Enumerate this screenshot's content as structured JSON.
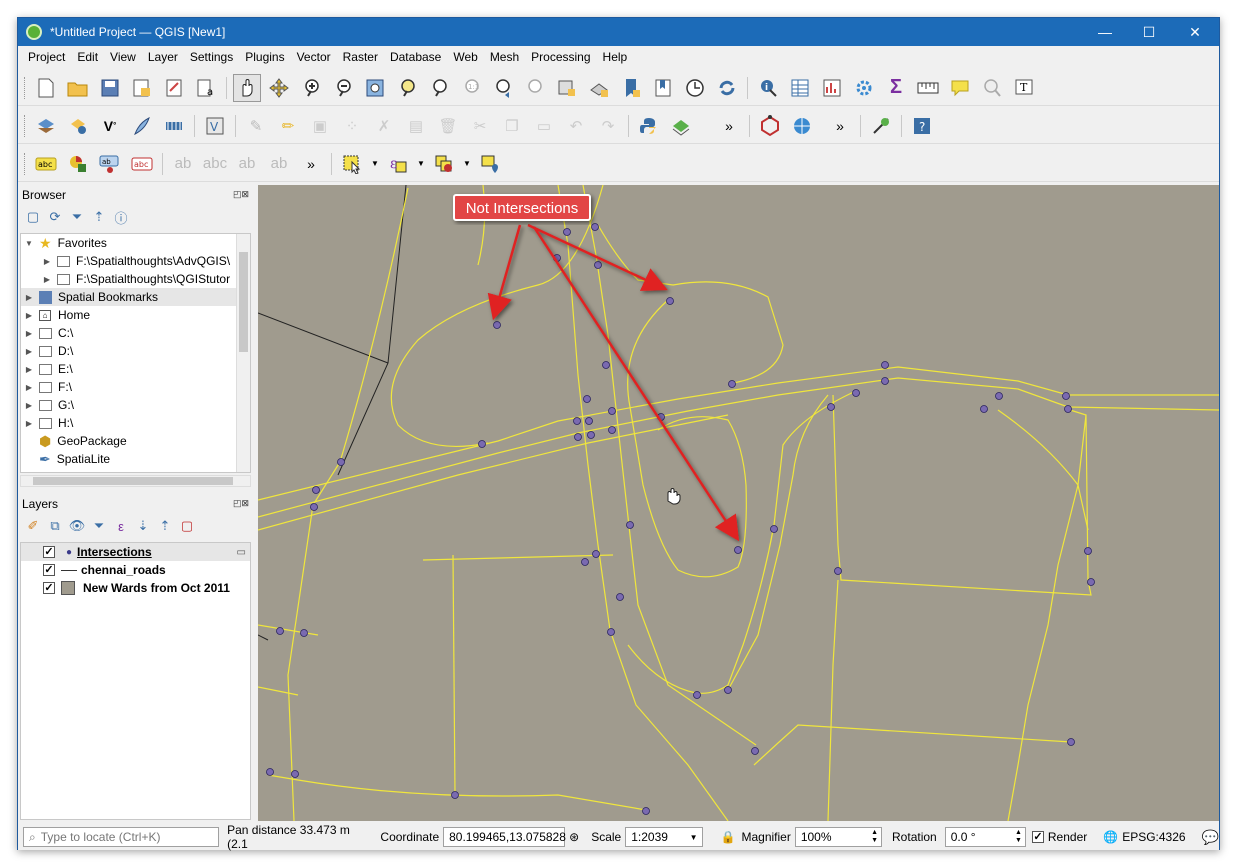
{
  "window": {
    "title": "*Untitled Project — QGIS [New1]",
    "minimize": "—",
    "maximize": "☐",
    "close": "✕"
  },
  "menu": [
    "Project",
    "Edit",
    "View",
    "Layer",
    "Settings",
    "Plugins",
    "Vector",
    "Raster",
    "Database",
    "Web",
    "Mesh",
    "Processing",
    "Help"
  ],
  "browser": {
    "title": "Browser",
    "items": [
      {
        "label": "Favorites",
        "icon": "star-icon",
        "level": 0,
        "expanded": true
      },
      {
        "label": "F:\\Spatialthoughts\\AdvQGIS\\",
        "icon": "folder-icon",
        "level": 1
      },
      {
        "label": "F:\\Spatialthoughts\\QGIStutor",
        "icon": "folder-icon",
        "level": 1
      },
      {
        "label": "Spatial Bookmarks",
        "icon": "bookmark-icon",
        "level": 0,
        "selected": true
      },
      {
        "label": "Home",
        "icon": "home-icon",
        "level": 0
      },
      {
        "label": "C:\\",
        "icon": "folder-icon",
        "level": 0
      },
      {
        "label": "D:\\",
        "icon": "folder-icon",
        "level": 0
      },
      {
        "label": "E:\\",
        "icon": "folder-icon",
        "level": 0
      },
      {
        "label": "F:\\",
        "icon": "folder-icon",
        "level": 0
      },
      {
        "label": "G:\\",
        "icon": "folder-icon",
        "level": 0
      },
      {
        "label": "H:\\",
        "icon": "folder-icon",
        "level": 0
      },
      {
        "label": "GeoPackage",
        "icon": "geopackage-icon",
        "level": 0
      },
      {
        "label": "SpatiaLite",
        "icon": "spatialite-icon",
        "level": 0
      }
    ]
  },
  "layers": {
    "title": "Layers",
    "items": [
      {
        "label": "Intersections",
        "symbol": "point",
        "checked": true,
        "active": true
      },
      {
        "label": "chennai_roads",
        "symbol": "line",
        "checked": true
      },
      {
        "label": "New Wards from Oct 2011",
        "symbol": "polygon",
        "checked": true
      }
    ]
  },
  "map": {
    "annotation": "Not Intersections",
    "background_color": "#a09b8e",
    "road_color": "#f0e63c",
    "point_color": "#7a6ab0"
  },
  "status": {
    "locate_placeholder": "Type to locate (Ctrl+K)",
    "pan_distance": "Pan distance 33.473 m (2.1",
    "coordinate_label": "Coordinate",
    "coordinate_value": "80.199465,13.075828",
    "scale_label": "Scale",
    "scale_value": "1:2039",
    "magnifier_label": "Magnifier",
    "magnifier_value": "100%",
    "rotation_label": "Rotation",
    "rotation_value": "0.0 °",
    "render_label": "Render",
    "crs": "EPSG:4326"
  }
}
